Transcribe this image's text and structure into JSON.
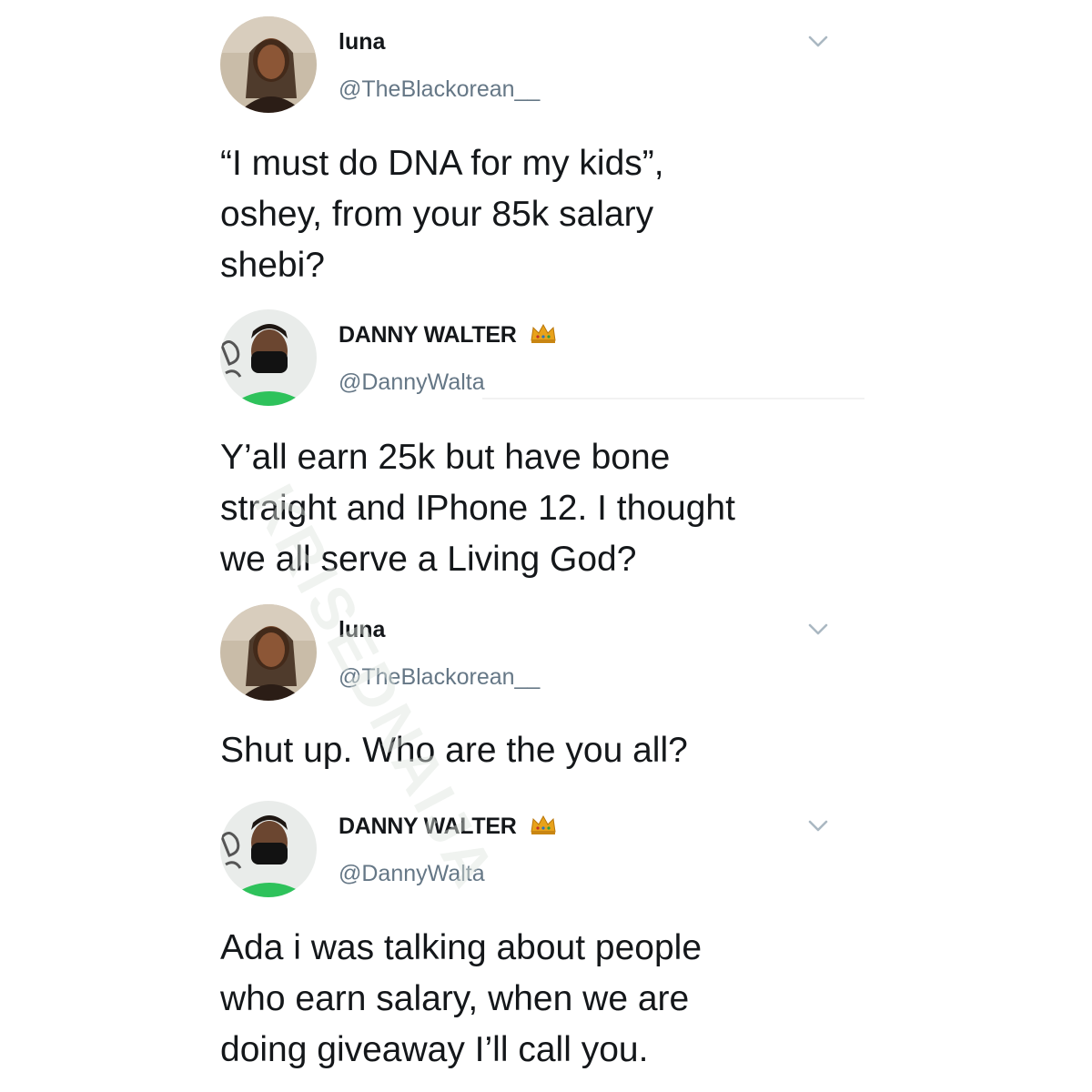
{
  "tweets": [
    {
      "display_name": "luna",
      "handle": "@TheBlackorean__",
      "verified_icon": "",
      "text": "“I must do DNA for my kids”,\noshey, from your 85k salary\nshebi?"
    },
    {
      "display_name": "DANNY WALTER",
      "handle": "@DannyWalta",
      "verified_icon": "crown-icon",
      "text": "Y’all earn 25k but have bone\nstraight and IPhone 12. I thought\nwe all serve a Living God?"
    },
    {
      "display_name": "luna",
      "handle": "@TheBlackorean__",
      "verified_icon": "",
      "text": "Shut up. Who are the you all?"
    },
    {
      "display_name": "DANNY WALTER",
      "handle": "@DannyWalta",
      "verified_icon": "crown-icon",
      "text": "Ada i was talking about people\nwho earn salary, when we are\ndoing giveaway I’ll call you."
    }
  ],
  "watermark": "KRISEDNAIJA",
  "colors": {
    "text": "#14171a",
    "handle": "#657786",
    "chevron": "#aab8c2",
    "crown": "#e8a21a"
  }
}
